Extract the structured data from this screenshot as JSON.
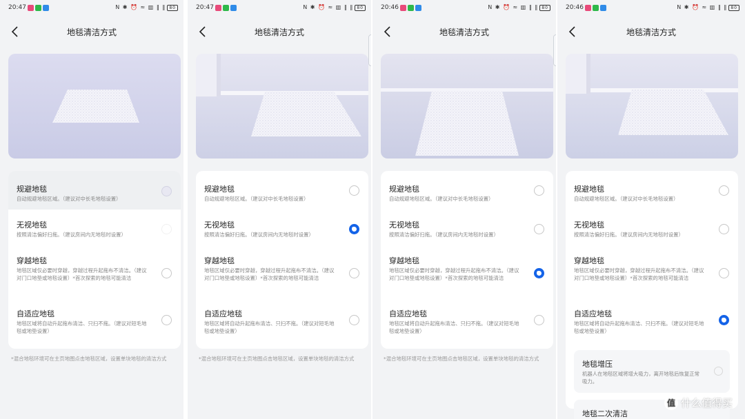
{
  "page_title": "地毯清洁方式",
  "footnote": "*混合地毯环境可在主页地图点击地毯区域，设置单块地毯的清洁方式",
  "status_times": [
    "20:47",
    "20:47",
    "20:46",
    "20:46"
  ],
  "status_icons": "N ✱ ⏰ ≈ ▥ ‖ ‖",
  "battery": "80",
  "options": [
    {
      "title": "规避地毯",
      "desc": "自动规避地毯区域。（建议对中长毛地毯设置）"
    },
    {
      "title": "无视地毯",
      "desc": "按照清洁偏好扫拖。（建议房间内无地毯时设置）"
    },
    {
      "title": "穿越地毯",
      "desc": "地毯区域仅必要时穿越，穿越过程升起拖布不清洁。（建议对门口地垫或地毯设置）*首次探索的地毯可能清洁"
    },
    {
      "title": "自适应地毯",
      "desc": "地毯区域将自动升起拖布清洁、只扫不拖。（建议对短毛地毯或地垫设置）"
    }
  ],
  "selected_option": [
    0,
    1,
    2,
    3
  ],
  "extra": {
    "boost_title": "地毯增压",
    "boost_desc": "机器人在地毯区域将增大吸力，离开地毯后恢复正常吸力。",
    "second_title": "地毯二次清洁"
  },
  "watermark": "什么值得买",
  "watermark_logo": "值",
  "colors": {
    "accent": "#1463e8",
    "background": "#f2f3f5"
  }
}
